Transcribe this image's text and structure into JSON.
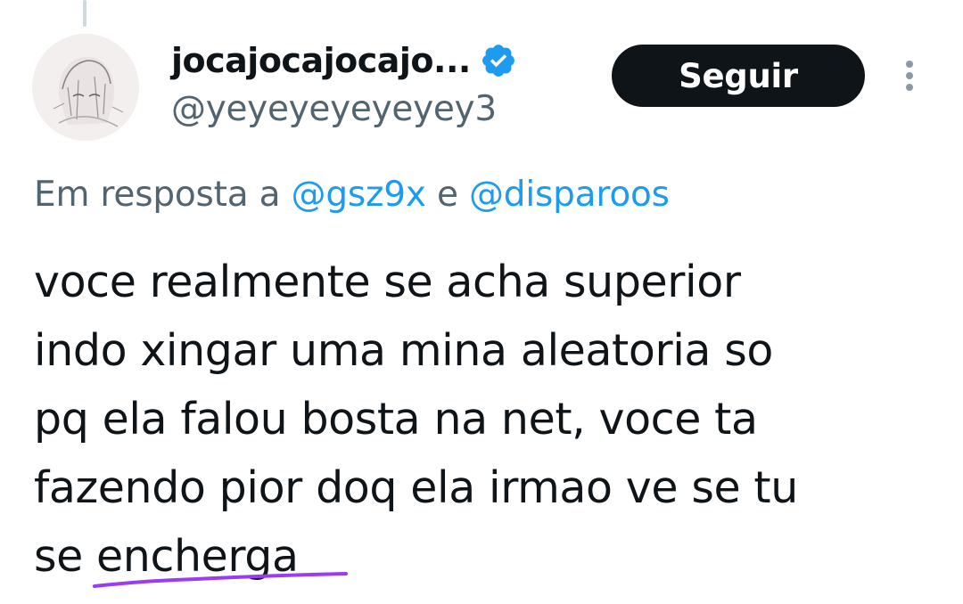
{
  "author": {
    "display_name": "jocajocajocajo...",
    "handle": "@yeyeyeyeyeyey3",
    "verified": true
  },
  "actions": {
    "follow_label": "Seguir"
  },
  "reply_context": {
    "prefix": "Em resposta a",
    "mention_1": "@gsz9x",
    "conjunction": "e",
    "mention_2": "@disparoos"
  },
  "tweet": {
    "lines": [
      "voce realmente se acha superior",
      "indo xingar uma mina aleatoria so",
      "pq ela falou bosta na net, voce ta",
      "fazendo pior doq ela irmao ve se tu",
      "se encherga"
    ]
  },
  "icons": {
    "avatar": "anime-sketch-avatar",
    "verified": "verified-badge-icon",
    "more": "more-vertical-icon"
  },
  "colors": {
    "text_primary": "#0f1419",
    "text_secondary": "#536471",
    "accent": "#1d9bf0",
    "button_bg": "#0f1419",
    "annotation_underline": "#9b3cf0"
  }
}
